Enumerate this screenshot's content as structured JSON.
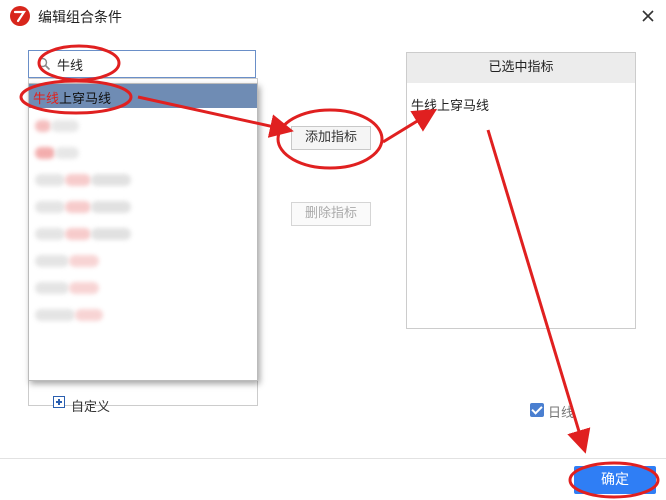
{
  "window": {
    "title": "编辑组合条件",
    "icons": {
      "app": "app-logo-icon",
      "close": "close-icon"
    }
  },
  "search": {
    "value": "牛线",
    "icon": "search-icon"
  },
  "dropdown": {
    "selected": {
      "highlight": "牛线",
      "rest": "上穿马线"
    }
  },
  "tree": {
    "footer_label": "自定义",
    "footer_icon": "plus-icon"
  },
  "buttons": {
    "add": "添加指标",
    "remove": "删除指标",
    "ok": "确定"
  },
  "selected_panel": {
    "header": "已选中指标",
    "items": [
      "牛线上穿马线"
    ]
  },
  "daily": {
    "label": "日线",
    "checked": true
  },
  "colors": {
    "accent": "#2f7ef5",
    "highlight_text": "#e0201c",
    "selected_row": "#6f8cb4",
    "annotation": "#e02020"
  }
}
